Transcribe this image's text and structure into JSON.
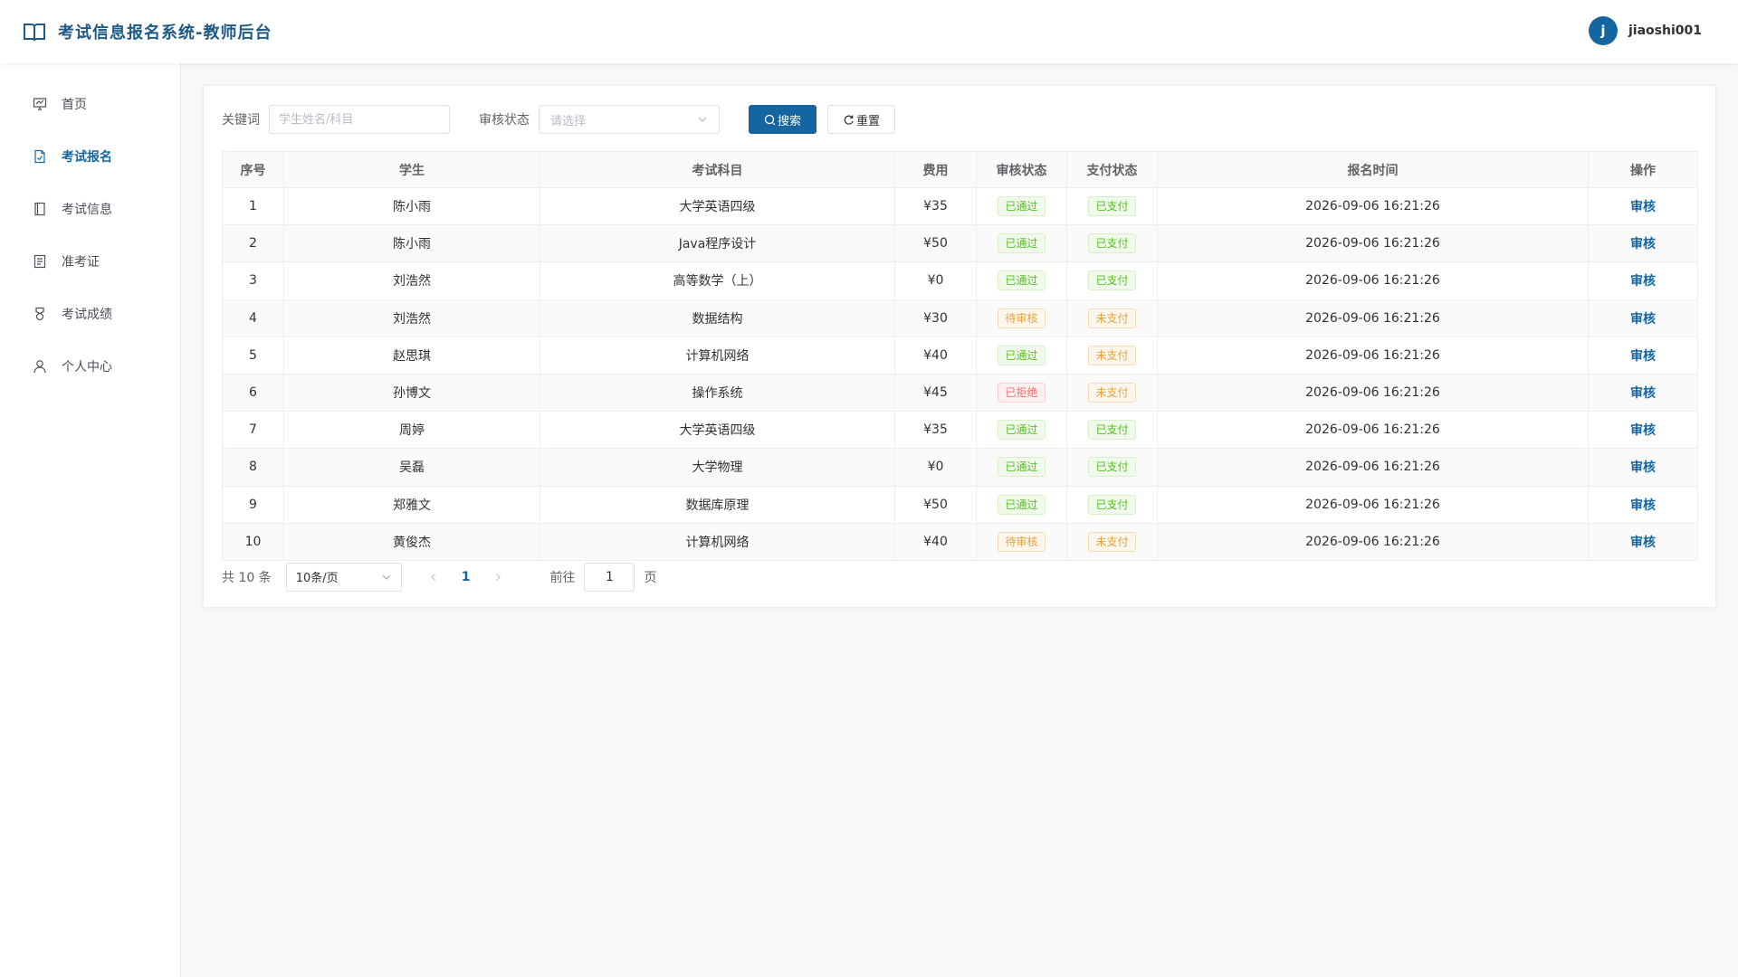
{
  "header": {
    "title": "考试信息报名系统-教师后台",
    "avatar_letter": "j",
    "username": "jiaoshi001"
  },
  "sidebar": {
    "items": [
      {
        "label": "首页",
        "icon": "dashboard-icon",
        "active": false
      },
      {
        "label": "考试报名",
        "icon": "document-check-icon",
        "active": true
      },
      {
        "label": "考试信息",
        "icon": "notebook-icon",
        "active": false
      },
      {
        "label": "准考证",
        "icon": "tickets-icon",
        "active": false
      },
      {
        "label": "考试成绩",
        "icon": "medal-icon",
        "active": false
      },
      {
        "label": "个人中心",
        "icon": "user-icon",
        "active": false
      }
    ]
  },
  "filter": {
    "keyword_label": "关键词",
    "keyword_placeholder": "学生姓名/科目",
    "status_label": "审核状态",
    "status_placeholder": "请选择",
    "search_label": "搜索",
    "reset_label": "重置"
  },
  "table": {
    "columns": [
      "序号",
      "学生",
      "考试科目",
      "费用",
      "审核状态",
      "支付状态",
      "报名时间",
      "操作"
    ],
    "rows": [
      {
        "no": "1",
        "student": "陈小雨",
        "subject": "大学英语四级",
        "fee": "¥35",
        "review": "已通过",
        "review_type": "ok",
        "pay": "已支付",
        "pay_type": "ok",
        "time": "2026-09-06 16:21:26",
        "action": "审核"
      },
      {
        "no": "2",
        "student": "陈小雨",
        "subject": "Java程序设计",
        "fee": "¥50",
        "review": "已通过",
        "review_type": "ok",
        "pay": "已支付",
        "pay_type": "ok",
        "time": "2026-09-06 16:21:26",
        "action": "审核"
      },
      {
        "no": "3",
        "student": "刘浩然",
        "subject": "高等数学（上）",
        "fee": "¥0",
        "review": "已通过",
        "review_type": "ok",
        "pay": "已支付",
        "pay_type": "ok",
        "time": "2026-09-06 16:21:26",
        "action": "审核"
      },
      {
        "no": "4",
        "student": "刘浩然",
        "subject": "数据结构",
        "fee": "¥30",
        "review": "待审核",
        "review_type": "warn",
        "pay": "未支付",
        "pay_type": "warn",
        "time": "2026-09-06 16:21:26",
        "action": "审核"
      },
      {
        "no": "5",
        "student": "赵思琪",
        "subject": "计算机网络",
        "fee": "¥40",
        "review": "已通过",
        "review_type": "ok",
        "pay": "未支付",
        "pay_type": "warn",
        "time": "2026-09-06 16:21:26",
        "action": "审核"
      },
      {
        "no": "6",
        "student": "孙博文",
        "subject": "操作系统",
        "fee": "¥45",
        "review": "已拒绝",
        "review_type": "err",
        "pay": "未支付",
        "pay_type": "warn",
        "time": "2026-09-06 16:21:26",
        "action": "审核"
      },
      {
        "no": "7",
        "student": "周婷",
        "subject": "大学英语四级",
        "fee": "¥35",
        "review": "已通过",
        "review_type": "ok",
        "pay": "已支付",
        "pay_type": "ok",
        "time": "2026-09-06 16:21:26",
        "action": "审核"
      },
      {
        "no": "8",
        "student": "吴磊",
        "subject": "大学物理",
        "fee": "¥0",
        "review": "已通过",
        "review_type": "ok",
        "pay": "已支付",
        "pay_type": "ok",
        "time": "2026-09-06 16:21:26",
        "action": "审核"
      },
      {
        "no": "9",
        "student": "郑雅文",
        "subject": "数据库原理",
        "fee": "¥50",
        "review": "已通过",
        "review_type": "ok",
        "pay": "已支付",
        "pay_type": "ok",
        "time": "2026-09-06 16:21:26",
        "action": "审核"
      },
      {
        "no": "10",
        "student": "黄俊杰",
        "subject": "计算机网络",
        "fee": "¥40",
        "review": "待审核",
        "review_type": "warn",
        "pay": "未支付",
        "pay_type": "warn",
        "time": "2026-09-06 16:21:26",
        "action": "审核"
      }
    ]
  },
  "pagination": {
    "total_text": "共 10 条",
    "page_size": "10条/页",
    "current_page": "1",
    "goto_label": "前往",
    "goto_value": "1",
    "page_suffix": "页"
  },
  "colors": {
    "primary": "#1565a0",
    "success": "#52c41a",
    "warning": "#e6a23c",
    "danger": "#f56c6c"
  }
}
